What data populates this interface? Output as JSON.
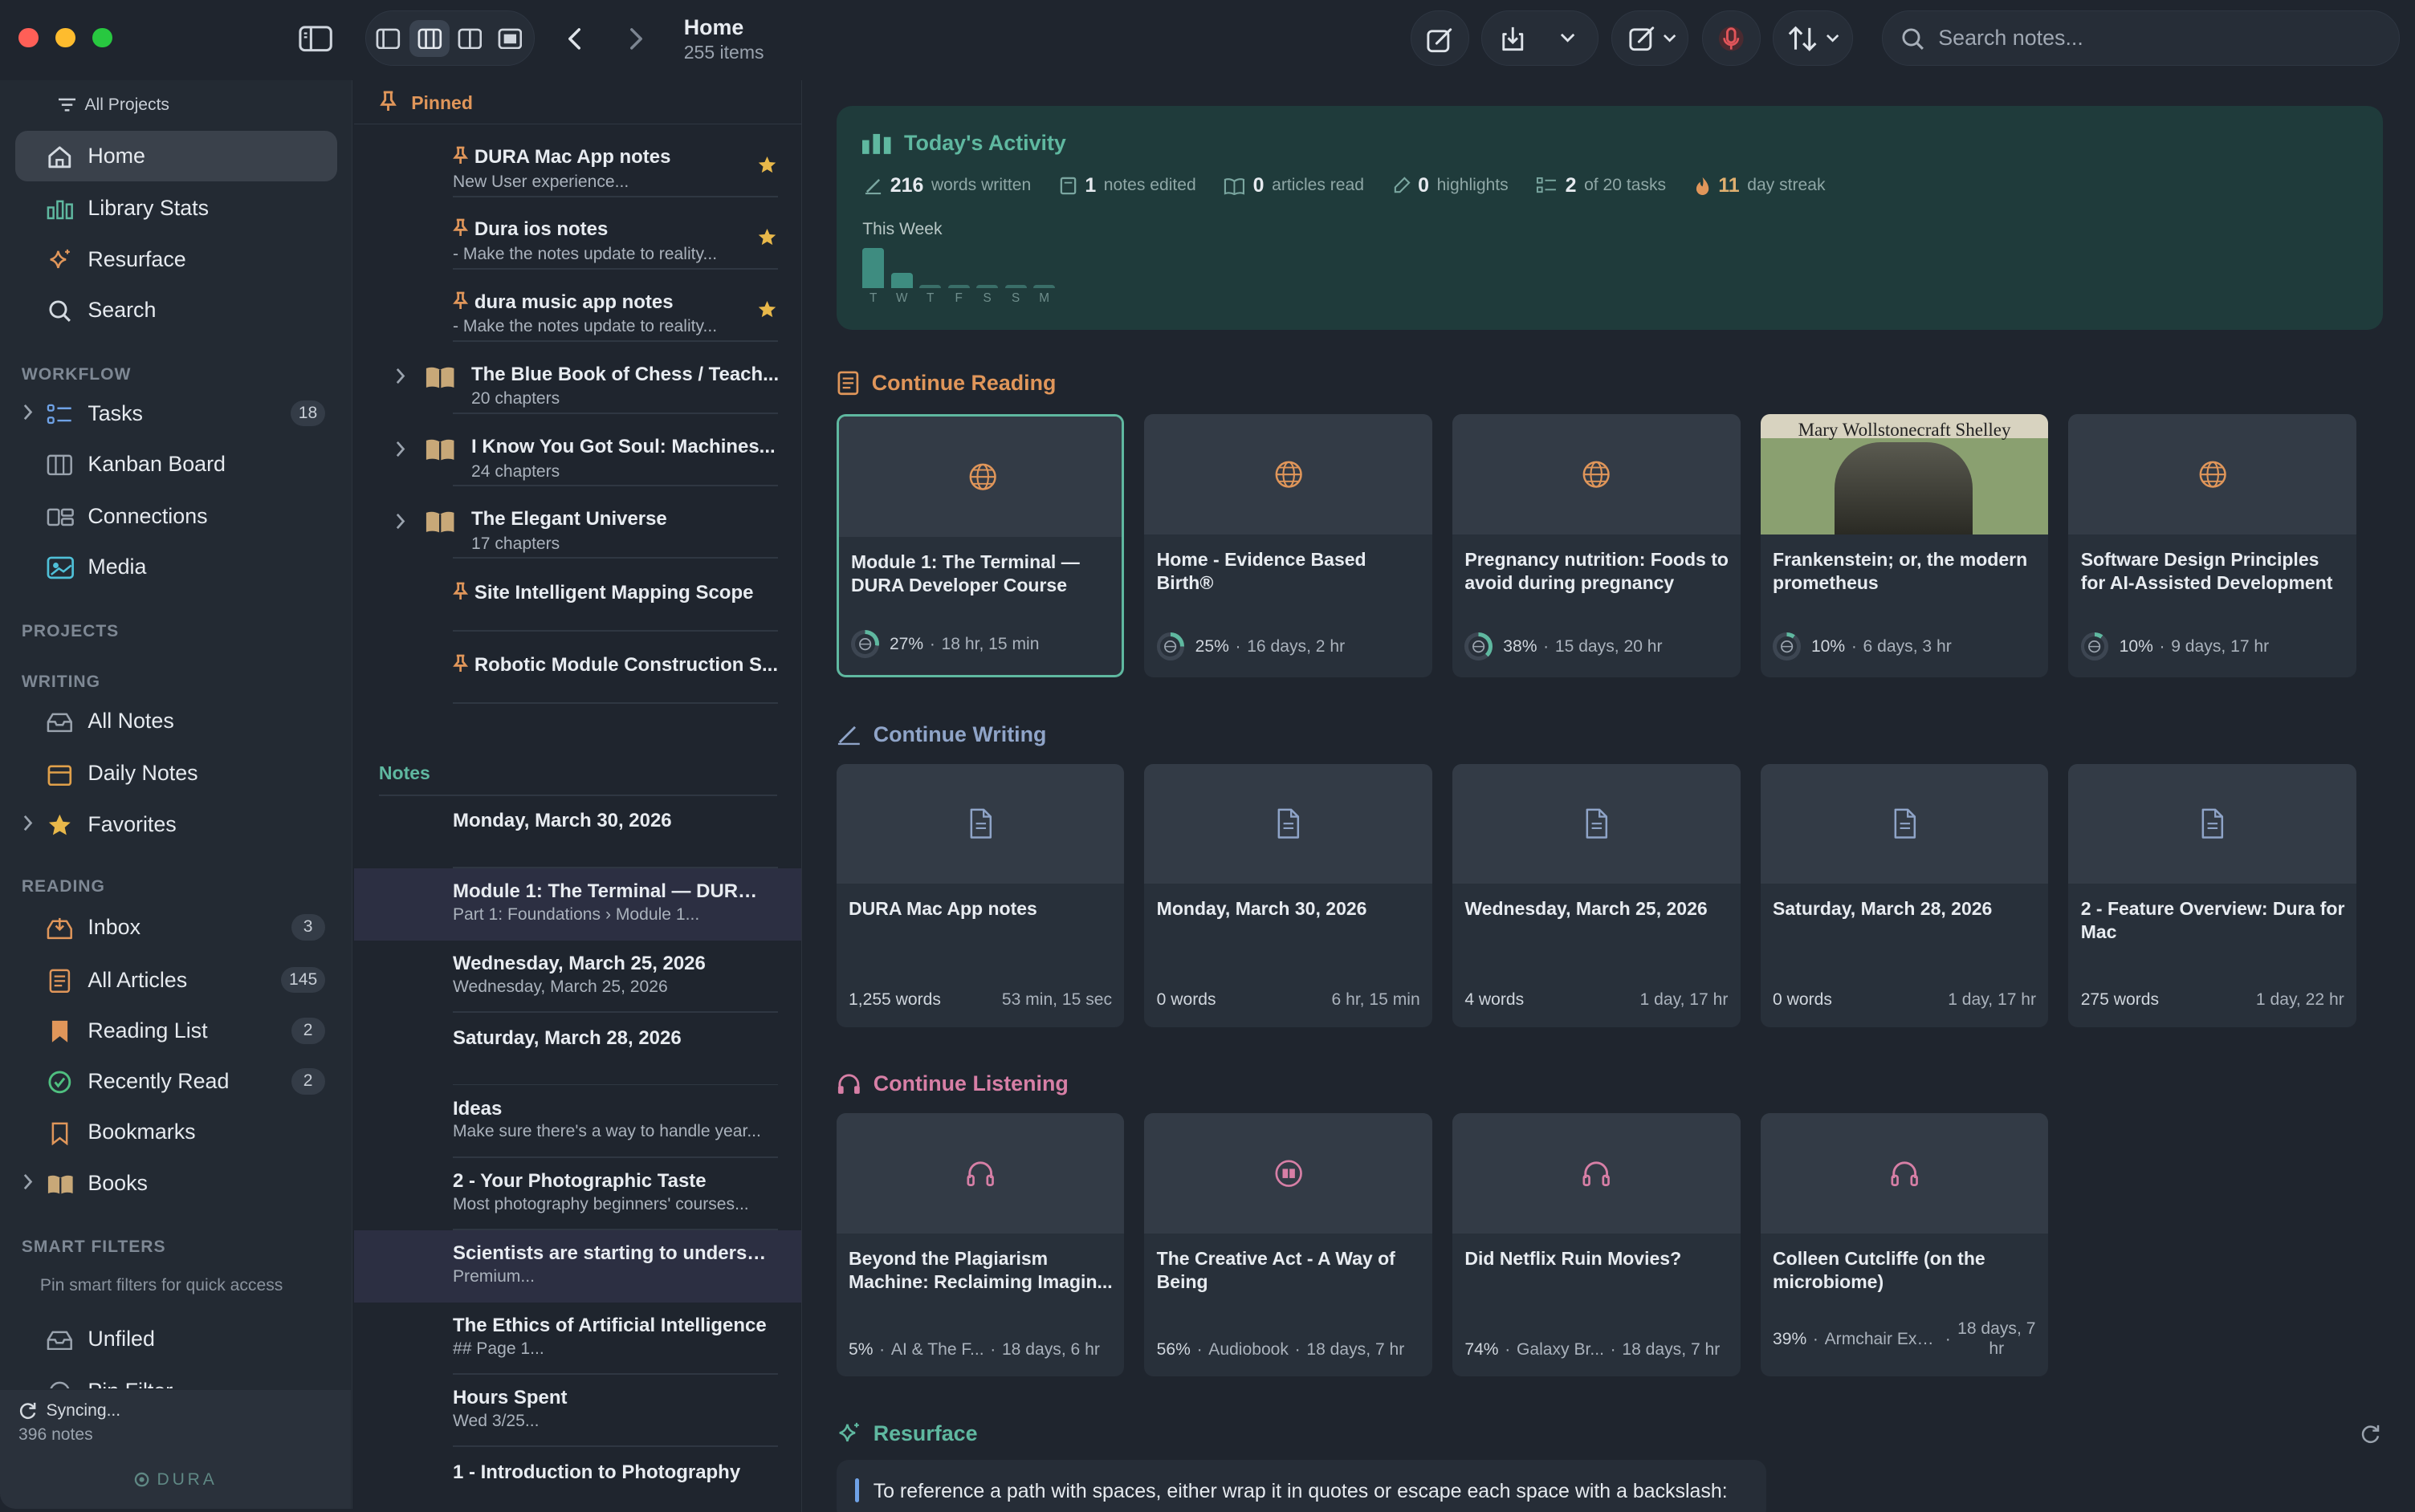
{
  "colors": {
    "accent_teal": "#5fb8a0",
    "accent_orange": "#e0965a",
    "accent_pink": "#d77fa6",
    "accent_blue": "#8fa4c8",
    "close": "#ff5f57",
    "minimize": "#febc2e",
    "zoom": "#28c840"
  },
  "toolbar": {
    "title": "Home",
    "subtitle": "255 items",
    "search_placeholder": "Search notes...",
    "icons": [
      "sidebar-toggle-icon",
      "layout-1-icon",
      "layout-2-icon",
      "layout-3-icon",
      "layout-4-icon",
      "back-icon",
      "forward-icon",
      "compose-icon",
      "import-icon",
      "chevron-down-icon",
      "new-note-icon",
      "microphone-icon",
      "sort-icon"
    ]
  },
  "sidebar": {
    "all_projects": "All Projects",
    "top": [
      {
        "label": "Home",
        "icon": "home-icon"
      },
      {
        "label": "Library Stats",
        "icon": "stats-icon"
      },
      {
        "label": "Resurface",
        "icon": "sparkle-icon"
      },
      {
        "label": "Search",
        "icon": "search-icon"
      }
    ],
    "sections": {
      "workflow": "WORKFLOW",
      "projects": "PROJECTS",
      "writing": "WRITING",
      "reading": "READING",
      "smart_filters": "SMART FILTERS"
    },
    "workflow": [
      {
        "label": "Tasks",
        "count": "18",
        "icon": "tasks-icon"
      },
      {
        "label": "Kanban Board",
        "icon": "kanban-icon"
      },
      {
        "label": "Connections",
        "icon": "connections-icon"
      },
      {
        "label": "Media",
        "icon": "media-icon"
      }
    ],
    "writing": [
      {
        "label": "All Notes",
        "icon": "inbox-tray-icon"
      },
      {
        "label": "Daily Notes",
        "icon": "calendar-icon"
      },
      {
        "label": "Favorites",
        "icon": "star-icon"
      }
    ],
    "reading": [
      {
        "label": "Inbox",
        "count": "3",
        "icon": "inbox-icon"
      },
      {
        "label": "All Articles",
        "count": "145",
        "icon": "articles-icon"
      },
      {
        "label": "Reading List",
        "count": "2",
        "icon": "bookmark-filled-icon"
      },
      {
        "label": "Recently Read",
        "count": "2",
        "icon": "check-circle-icon"
      },
      {
        "label": "Bookmarks",
        "icon": "bookmark-icon"
      },
      {
        "label": "Books",
        "icon": "book-icon"
      }
    ],
    "smart_hint": "Pin smart filters for quick access",
    "smart": [
      {
        "label": "Unfiled",
        "icon": "tray-icon"
      },
      {
        "label": "Pin Filter",
        "icon": "pin-icon"
      }
    ],
    "sync": {
      "status": "Syncing...",
      "notes": "396 notes",
      "brand": "DURA"
    }
  },
  "middle": {
    "pinned_label": "Pinned",
    "notes_label": "Notes",
    "pinned": [
      {
        "title": "DURA Mac App notes",
        "sub": "New User experience...",
        "kind": "pin",
        "star": true
      },
      {
        "title": "Dura ios notes",
        "sub": "- Make the notes update to reality...",
        "kind": "pin",
        "star": true
      },
      {
        "title": "dura music app notes",
        "sub": "- Make the notes update to reality...",
        "kind": "pin",
        "star": true
      },
      {
        "title": "The Blue Book of Chess / Teach...",
        "sub": "20 chapters",
        "kind": "book"
      },
      {
        "title": "I Know You Got Soul: Machines...",
        "sub": "24 chapters",
        "kind": "book"
      },
      {
        "title": "The Elegant Universe",
        "sub": "17 chapters",
        "kind": "book"
      },
      {
        "title": "Site Intelligent Mapping Scope",
        "sub": "",
        "kind": "pin"
      },
      {
        "title": "Robotic Module Construction S...",
        "sub": "",
        "kind": "pin"
      }
    ],
    "notes": [
      {
        "title": "Monday, March 30, 2026",
        "sub": ""
      },
      {
        "title": "Module 1: The Terminal — DURA D...",
        "sub": "Part 1: Foundations &rsaquo; Module 1...",
        "selected": true
      },
      {
        "title": "Wednesday, March 25, 2026",
        "sub": "Wednesday, March 25, 2026"
      },
      {
        "title": "Saturday, March 28, 2026",
        "sub": ""
      },
      {
        "title": "Ideas",
        "sub": "Make sure there's a way to handle year..."
      },
      {
        "title": "2 - Your Photographic Taste",
        "sub": "Most photography beginners' courses..."
      },
      {
        "title": "Scientists are starting to understa...",
        "sub": "Premium...",
        "selected": true
      },
      {
        "title": "The Ethics of Artificial Intelligence",
        "sub": "## Page 1..."
      },
      {
        "title": "Hours Spent",
        "sub": "Wed 3/25..."
      },
      {
        "title": "1 - Introduction to Photography",
        "sub": ""
      }
    ]
  },
  "activity": {
    "title": "Today's Activity",
    "stats": [
      {
        "value": "216",
        "label": "words written",
        "icon": "pen-icon"
      },
      {
        "value": "1",
        "label": "notes edited",
        "icon": "note-icon"
      },
      {
        "value": "0",
        "label": "articles read",
        "icon": "book-open-icon"
      },
      {
        "value": "0",
        "label": "highlights",
        "icon": "highlighter-icon"
      },
      {
        "value": "2",
        "label": "of 20 tasks",
        "icon": "checklist-icon"
      },
      {
        "value": "11",
        "label": "day streak",
        "icon": "flame-icon"
      }
    ],
    "week_label": "This Week",
    "days": [
      "T",
      "W",
      "T",
      "F",
      "S",
      "S",
      "M"
    ],
    "week_values": [
      1,
      0.4,
      0.05,
      0.05,
      0.05,
      0.05,
      0.05
    ]
  },
  "reading": {
    "title": "Continue Reading",
    "cards": [
      {
        "title": "Module 1: The Terminal — DURA Developer Course",
        "pct": "27%",
        "time": "18 hr, 15 min",
        "progress": 0.27,
        "thumb": "globe-icon",
        "active": true
      },
      {
        "title": "Home - Evidence Based Birth®",
        "pct": "25%",
        "time": "16 days, 2 hr",
        "progress": 0.25,
        "thumb": "globe-icon"
      },
      {
        "title": "Pregnancy nutrition: Foods to avoid during pregnancy",
        "pct": "38%",
        "time": "15 days, 20 hr",
        "progress": 0.38,
        "thumb": "globe-icon"
      },
      {
        "title": "Frankenstein; or, the modern prometheus",
        "pct": "10%",
        "time": "6 days, 3 hr",
        "progress": 0.1,
        "thumb": "book-cover",
        "cover_text": "Mary Wollstonecraft Shelley"
      },
      {
        "title": "Software Design Principles for AI-Assisted Development",
        "pct": "10%",
        "time": "9 days, 17 hr",
        "progress": 0.1,
        "thumb": "globe-icon"
      }
    ]
  },
  "writing": {
    "title": "Continue Writing",
    "cards": [
      {
        "title": "DURA Mac App notes",
        "words": "1,255 words",
        "time": "53 min, 15 sec"
      },
      {
        "title": "Monday, March 30, 2026",
        "words": "0 words",
        "time": "6 hr, 15 min"
      },
      {
        "title": "Wednesday, March 25, 2026",
        "words": "4 words",
        "time": "1 day, 17 hr"
      },
      {
        "title": "Saturday, March 28, 2026",
        "words": "0 words",
        "time": "1 day, 17 hr"
      },
      {
        "title": "2 - Feature Overview: Dura for Mac",
        "words": "275 words",
        "time": "1 day, 22 hr"
      }
    ]
  },
  "listening": {
    "title": "Continue Listening",
    "cards": [
      {
        "title": "Beyond the Plagiarism Machine: Reclaiming Imagin...",
        "pct": "5%",
        "src": "AI & The F...",
        "time": "18 days, 6 hr",
        "thumb": "headphones-icon"
      },
      {
        "title": "The Creative Act - A Way of Being",
        "pct": "56%",
        "src": "Audiobook",
        "time": "18 days, 7 hr",
        "thumb": "audiobook-icon"
      },
      {
        "title": "Did Netflix Ruin Movies?",
        "pct": "74%",
        "src": "Galaxy Br...",
        "time": "18 days, 7 hr",
        "thumb": "headphones-icon"
      },
      {
        "title": "Colleen Cutcliffe (on the microbiome)",
        "pct": "39%",
        "src": "Armchair Exp...",
        "time": "18 days, 7 hr",
        "thumb": "headphones-icon"
      }
    ]
  },
  "resurface": {
    "title": "Resurface",
    "quote": "To reference a path with spaces, either wrap it in quotes or escape each space with a backslash:"
  }
}
